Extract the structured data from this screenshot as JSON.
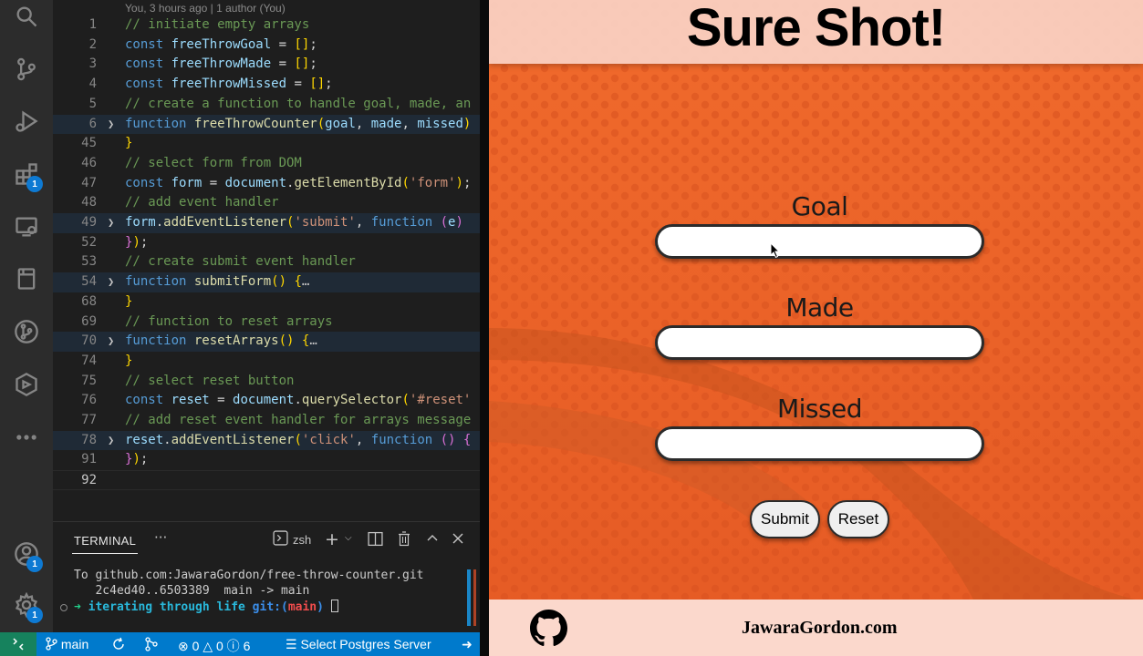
{
  "editor": {
    "blame": "You, 3 hours ago | 1 author (You)",
    "lines": [
      {
        "num": "1",
        "fold": false,
        "tokens": [
          {
            "t": "// initiate empty arrays",
            "c": "c-com"
          }
        ]
      },
      {
        "num": "2",
        "fold": false,
        "tokens": [
          {
            "t": "const ",
            "c": "c-kw"
          },
          {
            "t": "freeThrowGoal",
            "c": "c-var"
          },
          {
            "t": " = ",
            "c": ""
          },
          {
            "t": "[]",
            "c": "c-br1"
          },
          {
            "t": ";",
            "c": ""
          }
        ]
      },
      {
        "num": "3",
        "fold": false,
        "tokens": [
          {
            "t": "const ",
            "c": "c-kw"
          },
          {
            "t": "freeThrowMade",
            "c": "c-var"
          },
          {
            "t": " = ",
            "c": ""
          },
          {
            "t": "[]",
            "c": "c-br1"
          },
          {
            "t": ";",
            "c": ""
          }
        ]
      },
      {
        "num": "4",
        "fold": false,
        "tokens": [
          {
            "t": "const ",
            "c": "c-kw"
          },
          {
            "t": "freeThrowMissed",
            "c": "c-var"
          },
          {
            "t": " = ",
            "c": ""
          },
          {
            "t": "[]",
            "c": "c-br1"
          },
          {
            "t": ";",
            "c": ""
          }
        ]
      },
      {
        "num": "5",
        "fold": false,
        "tokens": [
          {
            "t": "// create a function to handle goal, made, an",
            "c": "c-com"
          }
        ]
      },
      {
        "num": "6",
        "fold": true,
        "tokens": [
          {
            "t": "function ",
            "c": "c-kw"
          },
          {
            "t": "freeThrowCounter",
            "c": "c-fn"
          },
          {
            "t": "(",
            "c": "c-br1"
          },
          {
            "t": "goal",
            "c": "c-var"
          },
          {
            "t": ", ",
            "c": ""
          },
          {
            "t": "made",
            "c": "c-var"
          },
          {
            "t": ", ",
            "c": ""
          },
          {
            "t": "missed",
            "c": "c-var"
          },
          {
            "t": ")",
            "c": "c-br1"
          }
        ]
      },
      {
        "num": "45",
        "fold": false,
        "tokens": [
          {
            "t": "}",
            "c": "c-br1"
          }
        ]
      },
      {
        "num": "46",
        "fold": false,
        "tokens": [
          {
            "t": "// select form from DOM",
            "c": "c-com"
          }
        ]
      },
      {
        "num": "47",
        "fold": false,
        "tokens": [
          {
            "t": "const ",
            "c": "c-kw"
          },
          {
            "t": "form",
            "c": "c-var"
          },
          {
            "t": " = ",
            "c": ""
          },
          {
            "t": "document",
            "c": "c-var"
          },
          {
            "t": ".",
            "c": ""
          },
          {
            "t": "getElementById",
            "c": "c-fn"
          },
          {
            "t": "(",
            "c": "c-br1"
          },
          {
            "t": "'form'",
            "c": "c-str"
          },
          {
            "t": ")",
            "c": "c-br1"
          },
          {
            "t": ";",
            "c": ""
          }
        ]
      },
      {
        "num": "48",
        "fold": false,
        "tokens": [
          {
            "t": "// add event handler",
            "c": "c-com"
          }
        ]
      },
      {
        "num": "49",
        "fold": true,
        "tokens": [
          {
            "t": "form",
            "c": "c-var"
          },
          {
            "t": ".",
            "c": ""
          },
          {
            "t": "addEventListener",
            "c": "c-fn"
          },
          {
            "t": "(",
            "c": "c-br1"
          },
          {
            "t": "'submit'",
            "c": "c-str"
          },
          {
            "t": ", ",
            "c": ""
          },
          {
            "t": "function ",
            "c": "c-kw"
          },
          {
            "t": "(",
            "c": "c-br2"
          },
          {
            "t": "e",
            "c": "c-var"
          },
          {
            "t": ")",
            "c": "c-br2"
          }
        ]
      },
      {
        "num": "52",
        "fold": false,
        "tokens": [
          {
            "t": "}",
            "c": "c-br2"
          },
          {
            "t": ")",
            "c": "c-br1"
          },
          {
            "t": ";",
            "c": ""
          }
        ]
      },
      {
        "num": "53",
        "fold": false,
        "tokens": [
          {
            "t": "// create submit event handler",
            "c": "c-com"
          }
        ]
      },
      {
        "num": "54",
        "fold": true,
        "tokens": [
          {
            "t": "function ",
            "c": "c-kw"
          },
          {
            "t": "submitForm",
            "c": "c-fn"
          },
          {
            "t": "() ",
            "c": "c-br1"
          },
          {
            "t": "{",
            "c": "c-br1"
          },
          {
            "t": "…",
            "c": "c-ell"
          }
        ]
      },
      {
        "num": "68",
        "fold": false,
        "tokens": [
          {
            "t": "}",
            "c": "c-br1"
          }
        ]
      },
      {
        "num": "69",
        "fold": false,
        "tokens": [
          {
            "t": "// function to reset arrays",
            "c": "c-com"
          }
        ]
      },
      {
        "num": "70",
        "fold": true,
        "tokens": [
          {
            "t": "function ",
            "c": "c-kw"
          },
          {
            "t": "resetArrays",
            "c": "c-fn"
          },
          {
            "t": "() ",
            "c": "c-br1"
          },
          {
            "t": "{",
            "c": "c-br1"
          },
          {
            "t": "…",
            "c": "c-ell"
          }
        ]
      },
      {
        "num": "74",
        "fold": false,
        "tokens": [
          {
            "t": "}",
            "c": "c-br1"
          }
        ]
      },
      {
        "num": "75",
        "fold": false,
        "tokens": [
          {
            "t": "// select reset button",
            "c": "c-com"
          }
        ]
      },
      {
        "num": "76",
        "fold": false,
        "tokens": [
          {
            "t": "const ",
            "c": "c-kw"
          },
          {
            "t": "reset",
            "c": "c-var"
          },
          {
            "t": " = ",
            "c": ""
          },
          {
            "t": "document",
            "c": "c-var"
          },
          {
            "t": ".",
            "c": ""
          },
          {
            "t": "querySelector",
            "c": "c-fn"
          },
          {
            "t": "(",
            "c": "c-br1"
          },
          {
            "t": "'#reset'",
            "c": "c-str"
          }
        ]
      },
      {
        "num": "77",
        "fold": false,
        "tokens": [
          {
            "t": "// add reset event handler for arrays message",
            "c": "c-com"
          }
        ]
      },
      {
        "num": "78",
        "fold": true,
        "tokens": [
          {
            "t": "reset",
            "c": "c-var"
          },
          {
            "t": ".",
            "c": ""
          },
          {
            "t": "addEventListener",
            "c": "c-fn"
          },
          {
            "t": "(",
            "c": "c-br1"
          },
          {
            "t": "'click'",
            "c": "c-str"
          },
          {
            "t": ", ",
            "c": ""
          },
          {
            "t": "function ",
            "c": "c-kw"
          },
          {
            "t": "() ",
            "c": "c-br2"
          },
          {
            "t": "{",
            "c": "c-br2"
          }
        ]
      },
      {
        "num": "91",
        "fold": false,
        "tokens": [
          {
            "t": "}",
            "c": "c-br2"
          },
          {
            "t": ")",
            "c": "c-br1"
          },
          {
            "t": ";",
            "c": ""
          }
        ]
      },
      {
        "num": "92",
        "fold": false,
        "tokens": []
      }
    ]
  },
  "terminal": {
    "tab_label": "TERMINAL",
    "more": "···",
    "shell": "zsh",
    "lines": [
      "To github.com:JawaraGordon/free-throw-counter.git",
      "   2c4ed40..6503389  main -> main"
    ],
    "prompt": {
      "arrow": "➜",
      "dir": "iterating through life",
      "git": "git:(",
      "branch": "main",
      "git_close": ")"
    }
  },
  "activity_bar": {
    "extensions_badge": "1",
    "accounts_badge": "1",
    "settings_badge": "1"
  },
  "statusbar": {
    "branch": "main",
    "errors": "0",
    "warnings": "0",
    "info": "6",
    "postgres": "Select Postgres Server"
  },
  "site": {
    "title": "Sure Shot!",
    "fields": {
      "goal_label": "Goal",
      "made_label": "Made",
      "missed_label": "Missed"
    },
    "buttons": {
      "submit": "Submit",
      "reset": "Reset"
    },
    "footer_link": "JawaraGordon.com",
    "colors": {
      "background": "#e8622a",
      "header": "#fad2c4",
      "footer": "#fbd8cc",
      "statusbar": "#007acc"
    }
  }
}
